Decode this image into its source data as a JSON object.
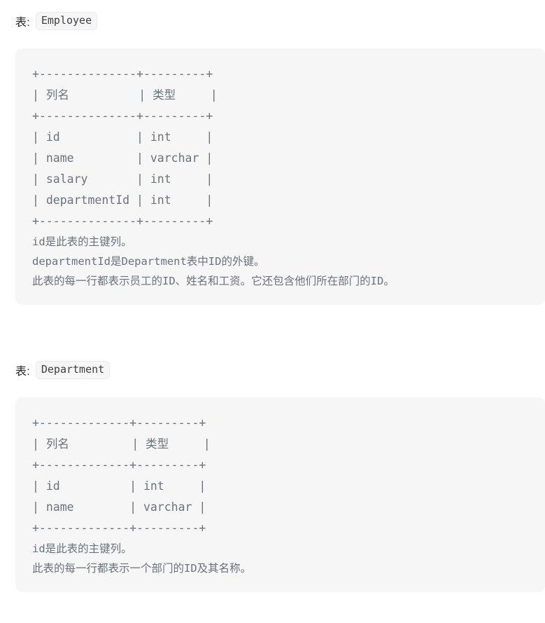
{
  "document": {
    "type": "sql-schema-description",
    "language": "zh-CN",
    "background_color": "#ffffff",
    "code_block_background": "#f6f6f7",
    "code_text_color": "#6a737d",
    "heading_text_color": "#1f2328"
  },
  "sections": [
    {
      "label_prefix": "表:",
      "table_name": "Employee",
      "schema_art": "+--------------+---------+\n| 列名          | 类型     |\n+--------------+---------+\n| id           | int     |\n| name         | varchar |\n| salary       | int     |\n| departmentId | int     |\n+--------------+---------+",
      "columns": [
        {
          "name": "id",
          "type": "int"
        },
        {
          "name": "name",
          "type": "varchar"
        },
        {
          "name": "salary",
          "type": "int"
        },
        {
          "name": "departmentId",
          "type": "int"
        }
      ],
      "column_headers": [
        "列名",
        "类型"
      ],
      "notes": "id是此表的主键列。\ndepartmentId是Department表中ID的外键。\n此表的每一行都表示员工的ID、姓名和工资。它还包含他们所在部门的ID。",
      "note_lines": [
        "id是此表的主键列。",
        "departmentId是Department表中ID的外键。",
        "此表的每一行都表示员工的ID、姓名和工资。它还包含他们所在部门的ID。"
      ]
    },
    {
      "label_prefix": "表:",
      "table_name": "Department",
      "schema_art": "+-------------+---------+\n| 列名         | 类型     |\n+-------------+---------+\n| id          | int     |\n| name        | varchar |\n+-------------+---------+",
      "columns": [
        {
          "name": "id",
          "type": "int"
        },
        {
          "name": "name",
          "type": "varchar"
        }
      ],
      "column_headers": [
        "列名",
        "类型"
      ],
      "notes": "id是此表的主键列。\n此表的每一行都表示一个部门的ID及其名称。",
      "note_lines": [
        "id是此表的主键列。",
        "此表的每一行都表示一个部门的ID及其名称。"
      ]
    }
  ]
}
